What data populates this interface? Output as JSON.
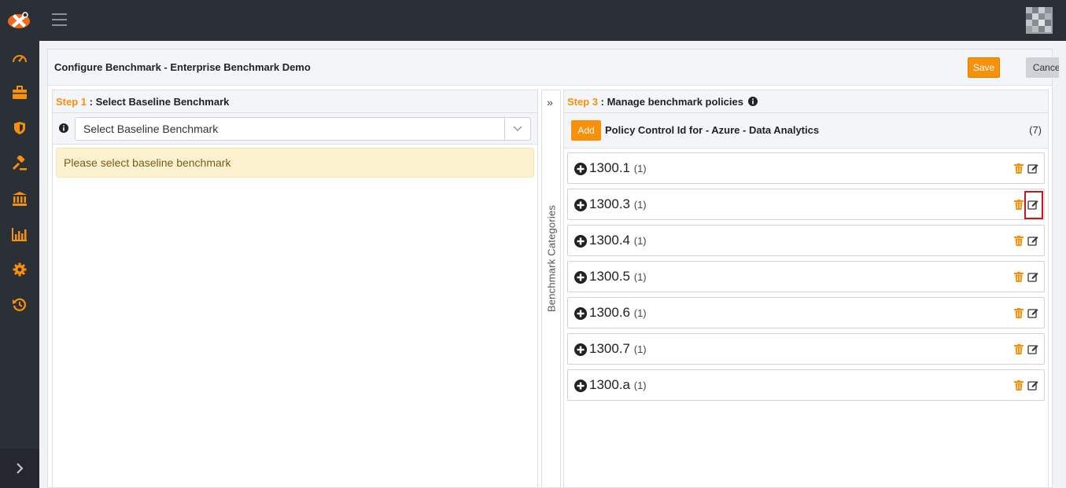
{
  "header": {
    "app_logo": "app-logo",
    "menu_icon": "hamburger-icon",
    "avatar": "user-avatar"
  },
  "sidebar": {
    "items": [
      {
        "icon": "dashboard-icon"
      },
      {
        "icon": "briefcase-icon"
      },
      {
        "icon": "shield-icon"
      },
      {
        "icon": "gavel-icon"
      },
      {
        "icon": "bank-icon"
      },
      {
        "icon": "bar-chart-icon"
      },
      {
        "icon": "gear-icon"
      },
      {
        "icon": "history-icon"
      }
    ],
    "expand_icon": "chevron-right-icon"
  },
  "page": {
    "title": "Configure Benchmark - Enterprise Benchmark Demo",
    "save_label": "Save",
    "cancel_label": "Cancel"
  },
  "step1": {
    "step_label": "Step 1",
    "title": " : Select Baseline Benchmark",
    "select_value": "Select Baseline Benchmark",
    "warning": "Please select baseline benchmark"
  },
  "categories": {
    "label": "Benchmark Categories",
    "toggle": "»"
  },
  "step3": {
    "step_label": "Step 3",
    "title": " : Manage benchmark policies",
    "add_label": "Add",
    "policy_title": "Policy Control Id for - Azure - Data Analytics",
    "count": "(7)",
    "items": [
      {
        "name": "1300.1",
        "count": "(1)"
      },
      {
        "name": "1300.3",
        "count": "(1)"
      },
      {
        "name": "1300.4",
        "count": "(1)"
      },
      {
        "name": "1300.5",
        "count": "(1)"
      },
      {
        "name": "1300.6",
        "count": "(1)"
      },
      {
        "name": "1300.7",
        "count": "(1)"
      },
      {
        "name": "1300.a",
        "count": "(1)"
      }
    ]
  },
  "colors": {
    "accent": "#f7900a",
    "topbar": "#2b2f36",
    "highlight": "#d0141a"
  }
}
